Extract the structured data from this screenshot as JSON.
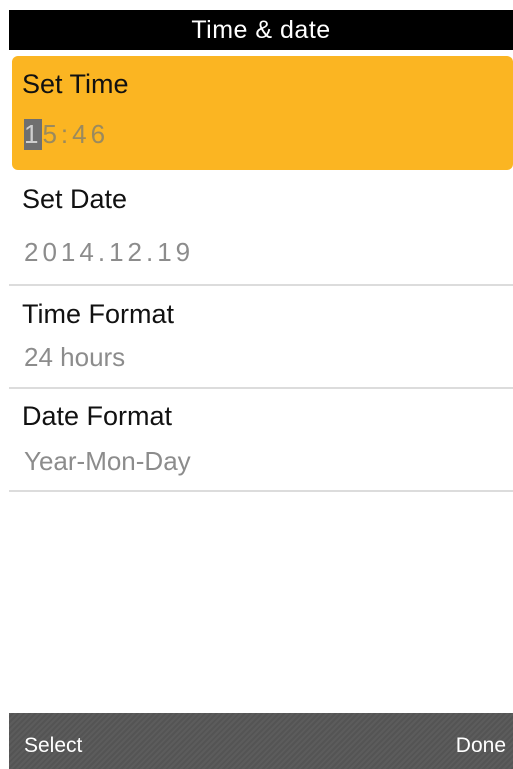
{
  "header": {
    "title": "Time & date"
  },
  "settings": {
    "items": [
      {
        "label": "Set Time",
        "value": "15:46",
        "cursor_char": "1",
        "value_rest": "5:46",
        "selected": true
      },
      {
        "label": "Set Date",
        "value": "2014.12.19",
        "selected": false
      },
      {
        "label": "Time Format",
        "value": "24 hours",
        "selected": false
      },
      {
        "label": "Date Format",
        "value": "Year-Mon-Day",
        "selected": false
      }
    ]
  },
  "softkeys": {
    "left_label": "Select",
    "right_label": "Done"
  },
  "colors": {
    "selection": "#fbb522",
    "title_bar": "#000000",
    "softkey_bar": "#5a5a5a",
    "value_text": "#8c8c8c"
  }
}
